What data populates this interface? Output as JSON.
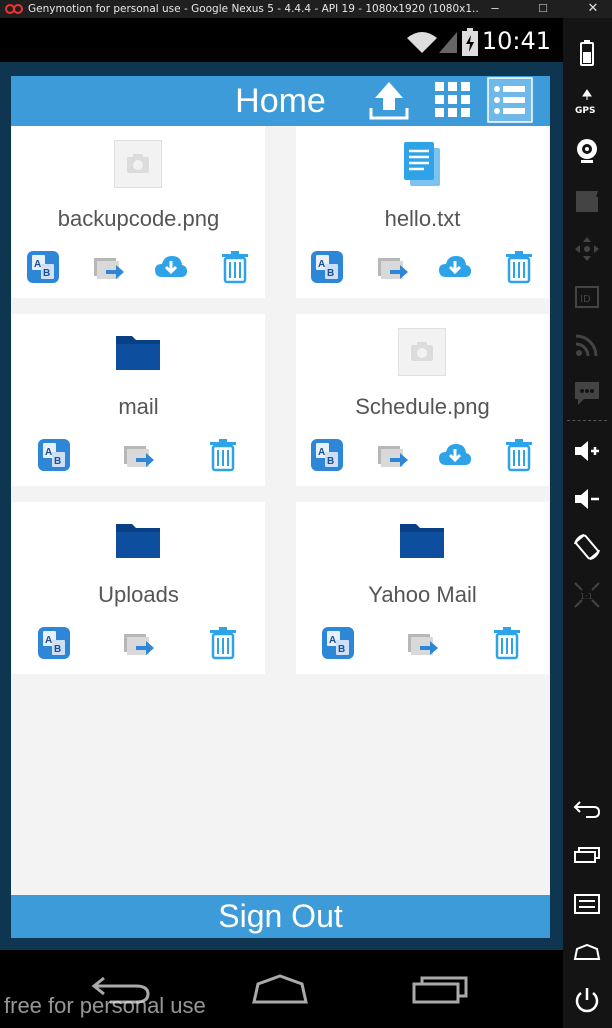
{
  "window": {
    "title": "Genymotion for personal use - Google Nexus 5 - 4.4.4 - API 19 - 1080x1920 (1080x1...",
    "minimize": "–",
    "maximize": "□",
    "close": "✕"
  },
  "status_bar": {
    "time": "10:41",
    "icons": [
      "wifi-icon",
      "signal-icon",
      "battery-icon"
    ]
  },
  "header": {
    "title": "Home",
    "actions": [
      "upload-icon",
      "grid-view-icon",
      "list-view-icon"
    ]
  },
  "files": [
    {
      "name": "backupcode.png",
      "type": "image",
      "actions": [
        "rename",
        "move",
        "download",
        "delete"
      ]
    },
    {
      "name": "hello.txt",
      "type": "text",
      "actions": [
        "rename",
        "move",
        "download",
        "delete"
      ]
    },
    {
      "name": "mail",
      "type": "folder",
      "actions": [
        "rename",
        "move",
        "delete"
      ]
    },
    {
      "name": "Schedule.png",
      "type": "image",
      "actions": [
        "rename",
        "move",
        "download",
        "delete"
      ]
    },
    {
      "name": "Uploads",
      "type": "folder",
      "actions": [
        "rename",
        "move",
        "delete"
      ]
    },
    {
      "name": "Yahoo Mail",
      "type": "folder",
      "actions": [
        "rename",
        "move",
        "delete"
      ]
    }
  ],
  "footer": {
    "sign_out": "Sign Out"
  },
  "nav_bar": [
    "back-icon",
    "home-icon",
    "recents-icon"
  ],
  "watermark": "free for personal use",
  "side_panel": [
    "battery-icon",
    "gps-icon",
    "webcam-icon",
    "video-capture-icon",
    "dpad-icon",
    "id-icon",
    "rss-icon",
    "sms-icon",
    "volume-up-icon",
    "volume-down-icon",
    "rotate-icon",
    "scale-icon",
    "back-icon",
    "recents-icon",
    "menu-icon",
    "home-icon",
    "power-icon"
  ],
  "colors": {
    "accent": "#3c9bd8",
    "folder": "#0d4f9e",
    "file_blue": "#2ea3e8",
    "app_background": "#f3f3f3"
  }
}
